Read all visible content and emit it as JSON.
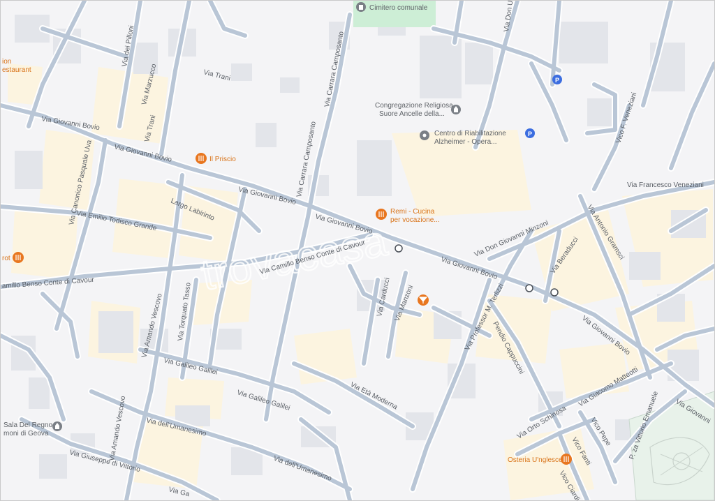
{
  "map": {
    "watermark": "trovacasa",
    "colors": {
      "background": "#f4f4f6",
      "road": "#b9c6d6",
      "road_edge": "#ffffff",
      "block": "#fcf4e0",
      "building": "#e3e5ea",
      "park": "#cdeed6",
      "food_poi": "#e8761f",
      "generic_poi": "#7a7f86",
      "parking": "#3b6de0"
    },
    "streets": {
      "via_dei_pilloni": "Via dei Pilloni",
      "via_trani_top": "Via Trani",
      "via_marzucco": "Via Marzucco",
      "via_trani_left": "Via Trani",
      "via_giovanni_bovio_1": "Via Giovanni Bovio",
      "via_giovanni_bovio_2": "Via Giovanni Bovio",
      "via_giovanni_bovio_3": "Via Giovanni Bovio",
      "via_giovanni_bovio_4": "Via Giovanni Bovio",
      "via_giovanni_bovio_5": "Via Giovanni Bovio",
      "via_giovanni_bovio_6": "Via Giovanni Bovio",
      "via_giovanni_bovio_7": "Via Giovanni",
      "via_canonico": "Via Canonico Pasquale Uva",
      "via_emilio": "Via Emilio Todisco Grande",
      "largo_labirinto": "Largo Labirinto",
      "via_carrara_camposanto_1": "Via Carrara Camposanto",
      "via_carrara_camposanto_2": "Via Carrara Camposanto",
      "via_cavour_1": "Via Camillo Benso Conte di Cavour",
      "via_cavour_2": "amillo Benso Conte di Cavour",
      "via_carducci": "Via Carducci",
      "via_manzoni": "Via Manzoni",
      "via_terlizzi": "Via Professor M. Terlizzi",
      "pendio_cappuccini": "Pendio Cappuccini",
      "via_don_minzoni": "Via Don Giovanni Minzoni",
      "via_antonio_gramsci": "Via Antonio Gramsci",
      "via_beraducci": "Via Beraducci",
      "via_francesco_veneziani": "Via Francesco Veneziani",
      "vico_veneziani": "Vico F. Veneziani",
      "via_don_top": "Via Don U",
      "via_amando_vescovo_1": "Via Amando Vescovo",
      "via_amando_vescovo_2": "Via Amando Vescovo",
      "via_torquato_tasso": "Via Torquato Tasso",
      "via_galileo_1": "Via Galileo Galilei",
      "via_galileo_2": "Via Galileo Galilei",
      "via_era_moderna": "Via Età Moderna",
      "via_umanesimo_1": "Via dell'Umanesimo",
      "via_umanesimo_2": "Via dell'Umanesimo",
      "via_giuseppe_vittorio": "Via Giuseppe di Vittorio",
      "via_ga_bottom": "Via Ga",
      "via_giacomo_matteotti": "Via Giacomo Matteotti",
      "via_orto_schinosa": "Via Orto Schinosa",
      "vico_pepe": "Vico Pepe",
      "vico_fanti": "Vico Fanti",
      "vico_ciardi": "Vico Ciardi",
      "p_za_vittorio_emanuele": "P. za Vittorio Emanuele"
    },
    "pois": {
      "cimitero": "Cimitero comunale",
      "congregazione_1": "Congregazione Religiosa",
      "congregazione_2": "Suore Ancelle della...",
      "centro_1": "Centro di Riabilitazione",
      "centro_2": "Alzheimer - Opera...",
      "il_priscio": "Il Priscio",
      "remi_1": "Remi - Cucina",
      "remi_2": "per vocazione...",
      "osteria": "Osteria U'nglesce",
      "sala_1": "Sala Del Regno",
      "sala_2": "moni di Geova",
      "restaurant_1": "ion",
      "restaurant_2": "estaurant",
      "rot": "rot"
    },
    "parking_label": "P"
  }
}
